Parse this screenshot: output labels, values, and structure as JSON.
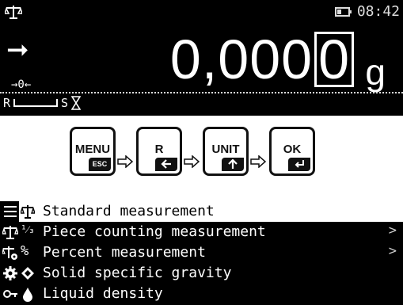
{
  "display": {
    "time": "08:42",
    "weight_main": "0,000",
    "weight_last_digit": "0",
    "unit": "g",
    "zero_indicator": "→0←",
    "stability_label": "S",
    "range_label": "R"
  },
  "keys": [
    {
      "label": "MENU",
      "sub": "ESC"
    },
    {
      "label": "R",
      "sub": "left-arrow-icon"
    },
    {
      "label": "UNIT",
      "sub": "up-arrow-icon"
    },
    {
      "label": "OK",
      "sub": "enter-icon"
    }
  ],
  "menu": {
    "items": [
      {
        "label": "Standard measurement",
        "icon": "scale-icon",
        "selected": true,
        "submenu": false
      },
      {
        "label": "Piece counting measurement",
        "icon": "fraction-icon",
        "selected": false,
        "submenu": true
      },
      {
        "label": "Percent measurement",
        "icon": "percent-icon",
        "selected": false,
        "submenu": true
      },
      {
        "label": "Solid specific gravity",
        "icon": "diamond-icon",
        "selected": false,
        "submenu": false
      },
      {
        "label": "Liquid density",
        "icon": "drop-icon",
        "selected": false,
        "submenu": false
      }
    ],
    "submenu_glyph": ">"
  },
  "colors": {
    "display_bg": "#000000",
    "display_fg": "#ffffff",
    "page_bg": "#ffffff"
  }
}
